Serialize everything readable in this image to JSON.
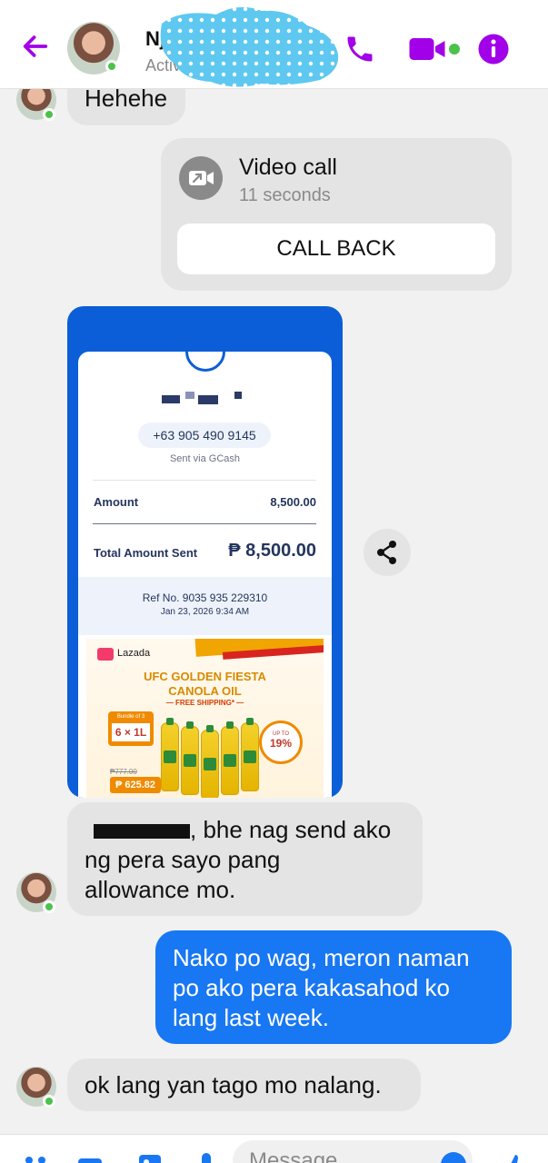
{
  "header": {
    "name": "Nj",
    "status": "Active now",
    "colors": {
      "accent": "#a100e8",
      "online": "#4cc24a"
    }
  },
  "messages": {
    "m1": "Hehehe",
    "m2_suffix": ", bhe nag send ako",
    "m2_line2": "ng pera sayo pang",
    "m2_line3": "allowance mo.",
    "m3_line1": "Nako po wag, meron naman",
    "m3_line2": "po ako pera kakasahod ko",
    "m3_line3": "lang last week.",
    "m4": "ok lang yan tago mo nalang."
  },
  "call_card": {
    "title": "Video call",
    "duration": "11 seconds",
    "button": "CALL BACK"
  },
  "receipt": {
    "phone": "+63 905 490 9145",
    "sent_via": "Sent via GCash",
    "amount_label": "Amount",
    "amount_value": "8,500.00",
    "total_label": "Total Amount Sent",
    "total_value": "₱ 8,500.00",
    "ref": "Ref No. 9035 935 229310",
    "date": "Jan 23, 2026 9:34 AM"
  },
  "ad": {
    "brand": "Lazada",
    "title_line1": "UFC GOLDEN FIESTA",
    "title_line2": "CANOLA OIL",
    "shipping": "— FREE SHIPPING* —",
    "bundle_small": "Bundle of 3",
    "bundle_big": "6 × 1L",
    "old_price": "₱777.00",
    "price": "₱ 625.82",
    "upto_small": "UP TO",
    "upto_big": "19%"
  },
  "composer": {
    "placeholder": "Message"
  }
}
